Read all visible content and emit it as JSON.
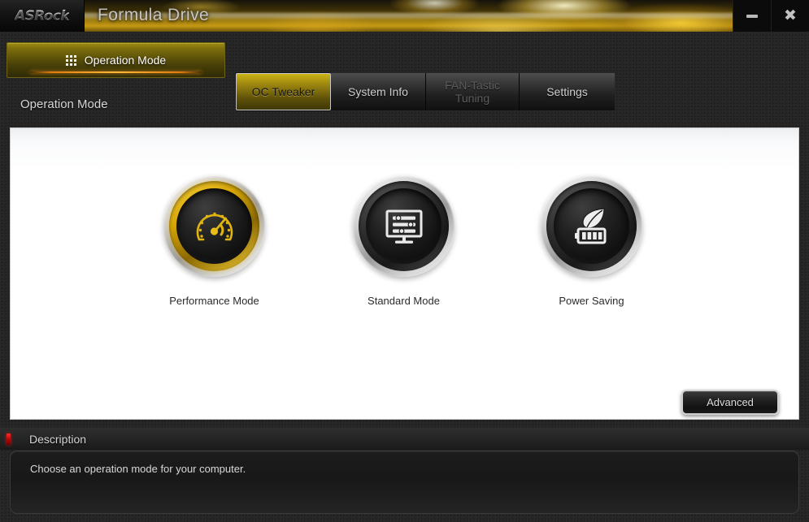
{
  "window": {
    "brand_logo": "ASRock",
    "app_title": "Formula Drive",
    "minimize_label": "Minimize",
    "close_label": "✖"
  },
  "nav": {
    "primary_tab": {
      "label": "Operation Mode",
      "icon": "grid-icon",
      "active": true
    },
    "tabs": [
      {
        "label": "OC Tweaker",
        "state": "active"
      },
      {
        "label": "System Info",
        "state": "normal"
      },
      {
        "label": "FAN-Tastic Tuning",
        "line1": "FAN-Tastic",
        "line2": "Tuning",
        "state": "disabled"
      },
      {
        "label": "Settings",
        "state": "normal"
      }
    ]
  },
  "page": {
    "section_title": "Operation Mode"
  },
  "modes": [
    {
      "label": "Performance Mode",
      "icon": "speedometer-icon",
      "selected": true,
      "ring_color": "#d9a707"
    },
    {
      "label": "Standard Mode",
      "icon": "monitor-sliders-icon",
      "selected": false,
      "ring_color": "#2c2c2c"
    },
    {
      "label": "Power Saving",
      "icon": "leaf-battery-icon",
      "selected": false,
      "ring_color": "#2c2c2c"
    }
  ],
  "actions": {
    "advanced_label": "Advanced"
  },
  "description": {
    "header": "Description",
    "marker_color": "#c00707",
    "text": "Choose an operation mode for your computer."
  },
  "theme": {
    "accent_gold": "#d9a707",
    "window_bg": "#262626",
    "panel_bg": "#ffffff",
    "text_light": "#d6d6d6"
  }
}
